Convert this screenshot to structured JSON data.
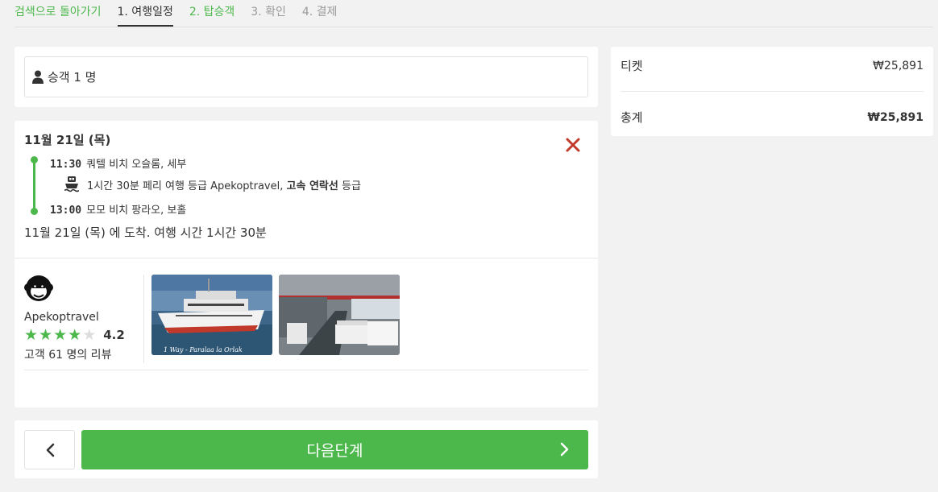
{
  "nav": {
    "back": "검색으로 돌아가기",
    "steps": [
      "1. 여행일정",
      "2. 탑승객",
      "3. 확인",
      "4. 결제"
    ]
  },
  "passengers": {
    "label": "승객 1 명",
    "icon": "person-icon"
  },
  "trip": {
    "date": "11월 21일 (목)",
    "depart": {
      "time": "11:30",
      "place": "쿼텔 비치 오슬롬, 세부"
    },
    "ferry": {
      "text": "1시간 30분 페리 여행 등급 Apekoptravel,",
      "class": "고속 연락선",
      "suffix": "등급",
      "icon": "ferry-icon"
    },
    "arrive": {
      "time": "13:00",
      "place": "모모 비치 팡라오, 보홀"
    },
    "arrival_note": "11월 21일 (목) 에 도착. 여행 시간 1시간 30분"
  },
  "operator": {
    "name": "Apekoptravel",
    "rating": "4.2",
    "stars_filled": 4,
    "stars_total": 5,
    "reviews": "고객 61 명의 리뷰",
    "photo_caption": "1 Way - Paralaa la Orlak"
  },
  "actions": {
    "next_label": "다음단계"
  },
  "summary": {
    "ticket_label": "티켓",
    "ticket_amount": "₩25,891",
    "total_label": "총계",
    "total_amount": "₩25,891"
  },
  "colors": {
    "accent": "#4cb84c",
    "close": "#c0392b"
  }
}
